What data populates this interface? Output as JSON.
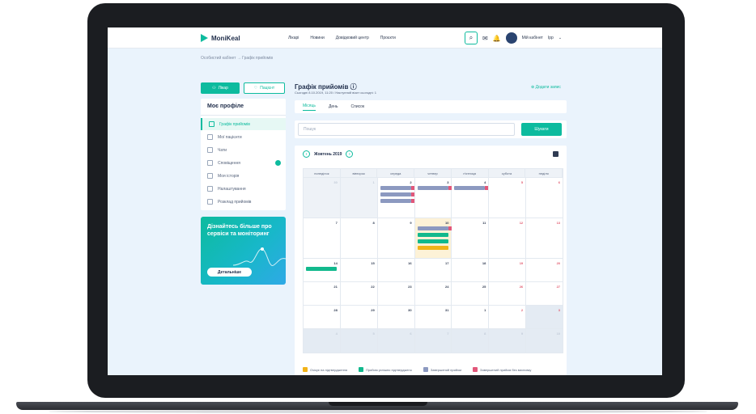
{
  "topbar": {
    "logo": "MoniKeal",
    "nav": [
      "Лікарі",
      "Новини",
      "Довідковий центр",
      "Проєкти"
    ],
    "cabinet": "Мій кабінет",
    "user": "Ірр"
  },
  "breadcrumb": "Особистий кабінет → Графік прийомів",
  "sidebar": {
    "tab_a": "Лікар",
    "tab_b": "Пацієнт",
    "title": "Моє профіле",
    "items": [
      {
        "label": "Графік прийомів"
      },
      {
        "label": "Мої пацієнти"
      },
      {
        "label": "Чати"
      },
      {
        "label": "Сповіщення"
      },
      {
        "label": "Моя історія"
      },
      {
        "label": "Налаштування"
      },
      {
        "label": "Розклад прийомів"
      }
    ]
  },
  "promo": {
    "text": "Дізнайтесь більше про сервіси та моніторинг",
    "button": "Детальніше"
  },
  "main": {
    "title": "Графік прийомів",
    "subtitle": "Сьогодні 8.10.2019, 11:20 / Наступний візит сьогодні: 1",
    "add_link": "Додати запис",
    "view_tabs": [
      "Місяць",
      "День",
      "Список"
    ],
    "search_placeholder": "Пошук",
    "search_button": "Шукати"
  },
  "calendar": {
    "month_label": "Жовтень 2019",
    "weekdays": [
      "понеділок",
      "вівторок",
      "середа",
      "четвер",
      "п'ятниця",
      "субота",
      "неділя"
    ],
    "weeks": [
      [
        "30",
        "1",
        "2",
        "3",
        "4",
        "5",
        "6"
      ],
      [
        "7",
        "8",
        "9",
        "10",
        "11",
        "12",
        "13"
      ],
      [
        "14",
        "15",
        "16",
        "17",
        "18",
        "19",
        "20"
      ],
      [
        "21",
        "22",
        "23",
        "24",
        "25",
        "26",
        "27"
      ],
      [
        "28",
        "29",
        "30",
        "31",
        "1",
        "2",
        "3"
      ],
      [
        "4",
        "5",
        "6",
        "7",
        "8",
        "9",
        "10"
      ]
    ]
  },
  "legend": [
    {
      "label": "Очікує на підтвердження",
      "color": "#f2b319"
    },
    {
      "label": "Прийом успішно підтверджено",
      "color": "#12b98d"
    },
    {
      "label": "Завершений прийом",
      "color": "#8c99c0"
    },
    {
      "label": "Завершений прийом без висновку",
      "color": "#e2577a"
    }
  ]
}
